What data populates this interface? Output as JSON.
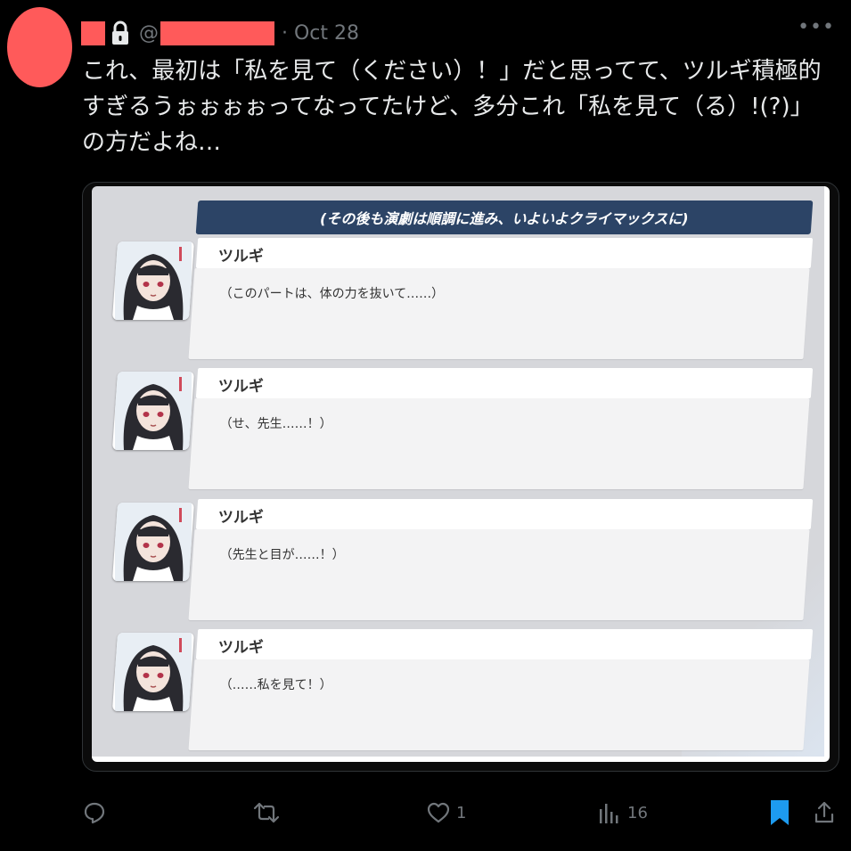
{
  "tweet": {
    "handle_prefix": "@",
    "date": "· Oct 28",
    "text": "これ、最初は「私を見て（ください）！」だと思ってて、ツルギ積極的すぎるうぉぉぉぉってなってたけど、多分これ「私を見て（る）!(?)」の方だよね…"
  },
  "media": {
    "banner": "(その後も演劇は順調に進み、いよいよクライマックスに)",
    "dialogues": [
      {
        "speaker": "ツルギ",
        "line": "（このパートは、体の力を抜いて……）"
      },
      {
        "speaker": "ツルギ",
        "line": "（せ、先生……！）"
      },
      {
        "speaker": "ツルギ",
        "line": "（先生と目が……！）"
      },
      {
        "speaker": "ツルギ",
        "line": "（……私を見て！）"
      }
    ]
  },
  "actions": {
    "reply_count": "",
    "retweet_count": "",
    "like_count": "1",
    "views_count": "16"
  },
  "colors": {
    "background": "#000000",
    "redaction": "#ff5a5a",
    "muted": "#71767b",
    "bookmark_active": "#1d9bf0",
    "banner": "#2c4466"
  }
}
